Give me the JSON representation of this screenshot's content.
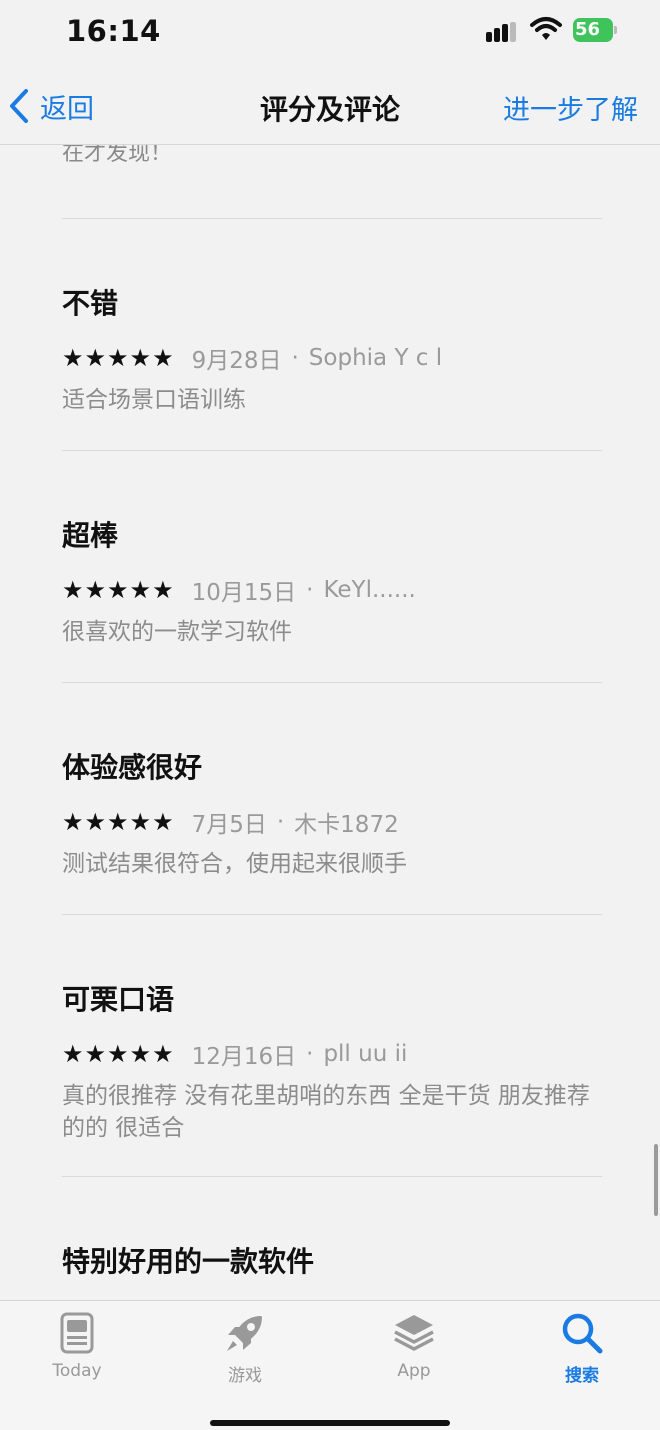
{
  "status_bar": {
    "time": "16:14",
    "battery_level": "56"
  },
  "nav": {
    "back_label": "返回",
    "title": "评分及评论",
    "learn_more": "进一步了解"
  },
  "partial_review": {
    "body_line2": "在才发现！"
  },
  "reviews": [
    {
      "title": "不错",
      "stars": 5,
      "date": "9月28日",
      "sep": "·",
      "author": "Sophia Y c l",
      "body": "适合场景口语训练"
    },
    {
      "title": "超棒",
      "stars": 5,
      "date": "10月15日",
      "sep": "·",
      "author": "KeYl......",
      "body": "很喜欢的一款学习软件"
    },
    {
      "title": "体验感很好",
      "stars": 5,
      "date": "7月5日",
      "sep": "·",
      "author": "木卡1872",
      "body": "测试结果很符合，使用起来很顺手"
    },
    {
      "title": "可栗口语",
      "stars": 5,
      "date": "12月16日",
      "sep": "·",
      "author": "pll uu ii",
      "body": "真的很推荐 没有花里胡哨的东西 全是干货 朋友推荐的的 很适合"
    },
    {
      "title": "特别好用的一款软件"
    }
  ],
  "tabs": [
    {
      "label": "Today",
      "icon": "today-icon",
      "active": false
    },
    {
      "label": "游戏",
      "icon": "rocket-icon",
      "active": false
    },
    {
      "label": "App",
      "icon": "layers-icon",
      "active": false
    },
    {
      "label": "搜索",
      "icon": "search-icon",
      "active": true
    }
  ],
  "colors": {
    "accent": "#1a7be3",
    "battery": "#3fc35b",
    "background": "#f2f2f2"
  }
}
